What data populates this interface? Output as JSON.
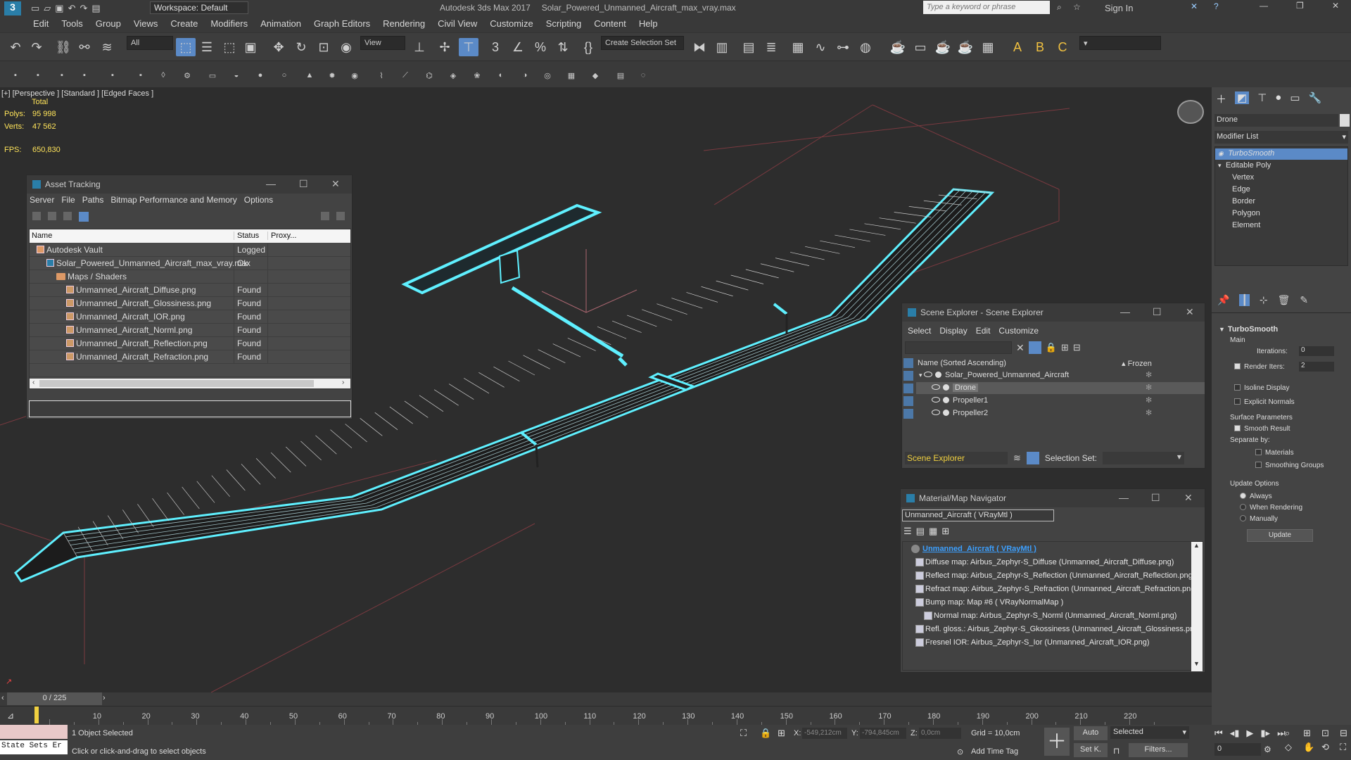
{
  "title": {
    "workspace": "Workspace: Default",
    "app": "Autodesk 3ds Max 2017",
    "file": "Solar_Powered_Unmanned_Aircraft_max_vray.max",
    "search_placeholder": "Type a keyword or phrase",
    "sign_in": "Sign In"
  },
  "menu": [
    "Edit",
    "Tools",
    "Group",
    "Views",
    "Create",
    "Modifiers",
    "Animation",
    "Graph Editors",
    "Rendering",
    "Civil View",
    "Customize",
    "Scripting",
    "Content",
    "Help"
  ],
  "toolbar": {
    "filter": "All",
    "view": "View",
    "selection_set": "Create Selection Set"
  },
  "viewport": {
    "label": "[+] [Perspective ] [Standard ] [Edged Faces ]",
    "total": "Total",
    "polys_label": "Polys:",
    "polys": "95 998",
    "verts_label": "Verts:",
    "verts": "47 562",
    "fps_label": "FPS:",
    "fps": "650,830",
    "wire_color": "#5ff0ff"
  },
  "asset_tracking": {
    "title": "Asset Tracking",
    "menu": [
      "Server",
      "File",
      "Paths",
      "Bitmap Performance and Memory",
      "Options"
    ],
    "columns": [
      "Name",
      "Status",
      "Proxy..."
    ],
    "rows": [
      {
        "name": "Autodesk Vault",
        "status": "Logged ...",
        "indent": 0,
        "icon": "vault-icon"
      },
      {
        "name": "Solar_Powered_Unmanned_Aircraft_max_vray.max",
        "status": "Ok",
        "indent": 1,
        "icon": "max-file-icon"
      },
      {
        "name": "Maps / Shaders",
        "status": "",
        "indent": 2,
        "icon": "folder-icon"
      },
      {
        "name": "Unmanned_Aircraft_Diffuse.png",
        "status": "Found",
        "indent": 3,
        "icon": "image-icon"
      },
      {
        "name": "Unmanned_Aircraft_Glossiness.png",
        "status": "Found",
        "indent": 3,
        "icon": "image-icon"
      },
      {
        "name": "Unmanned_Aircraft_IOR.png",
        "status": "Found",
        "indent": 3,
        "icon": "image-icon"
      },
      {
        "name": "Unmanned_Aircraft_Norml.png",
        "status": "Found",
        "indent": 3,
        "icon": "image-icon"
      },
      {
        "name": "Unmanned_Aircraft_Reflection.png",
        "status": "Found",
        "indent": 3,
        "icon": "image-icon"
      },
      {
        "name": "Unmanned_Aircraft_Refraction.png",
        "status": "Found",
        "indent": 3,
        "icon": "image-icon"
      }
    ]
  },
  "scene_explorer": {
    "title": "Scene Explorer - Scene Explorer",
    "menu": [
      "Select",
      "Display",
      "Edit",
      "Customize"
    ],
    "col_name": "Name (Sorted Ascending)",
    "col_frozen": "▴ Frozen",
    "items": [
      {
        "name": "Solar_Powered_Unmanned_Aircraft",
        "level": 0,
        "selected": false
      },
      {
        "name": "Drone",
        "level": 1,
        "selected": true
      },
      {
        "name": "Propeller1",
        "level": 1,
        "selected": false
      },
      {
        "name": "Propeller2",
        "level": 1,
        "selected": false
      }
    ],
    "footer_label": "Scene Explorer",
    "selection_set": "Selection Set:"
  },
  "material_navigator": {
    "title": "Material/Map Navigator",
    "current": "Unmanned_Aircraft  ( VRayMtl )",
    "items": [
      {
        "text": "Unmanned_Aircraft  ( VRayMtl )",
        "level": 0,
        "selected": true
      },
      {
        "text": "Diffuse map: Airbus_Zephyr-S_Diffuse (Unmanned_Aircraft_Diffuse.png)",
        "level": 1,
        "selected": false
      },
      {
        "text": "Reflect map: Airbus_Zephyr-S_Reflection (Unmanned_Aircraft_Reflection.png)",
        "level": 1,
        "selected": false
      },
      {
        "text": "Refract map: Airbus_Zephyr-S_Refraction (Unmanned_Aircraft_Refraction.png)",
        "level": 1,
        "selected": false
      },
      {
        "text": "Bump map: Map #6  ( VRayNormalMap )",
        "level": 1,
        "selected": false
      },
      {
        "text": "Normal map: Airbus_Zephyr-S_Norml (Unmanned_Aircraft_Norml.png)",
        "level": 2,
        "selected": false
      },
      {
        "text": "Refl. gloss.: Airbus_Zephyr-S_Gkossiness (Unmanned_Aircraft_Glossiness.png)",
        "level": 1,
        "selected": false
      },
      {
        "text": "Fresnel IOR: Airbus_Zephyr-S_Ior (Unmanned_Aircraft_IOR.png)",
        "level": 1,
        "selected": false
      }
    ]
  },
  "command_panel": {
    "object_name": "Drone",
    "modifier_list": "Modifier List",
    "stack": [
      {
        "name": "TurboSmooth",
        "level": 0,
        "selected": true
      },
      {
        "name": "Editable Poly",
        "level": 0,
        "selected": false
      },
      {
        "name": "Vertex",
        "level": 1,
        "selected": false
      },
      {
        "name": "Edge",
        "level": 1,
        "selected": false
      },
      {
        "name": "Border",
        "level": 1,
        "selected": false
      },
      {
        "name": "Polygon",
        "level": 1,
        "selected": false
      },
      {
        "name": "Element",
        "level": 1,
        "selected": false
      }
    ],
    "rollout_title": "TurboSmooth",
    "main": "Main",
    "iterations_label": "Iterations:",
    "iterations": "0",
    "render_iters_label": "Render Iters:",
    "render_iters": "2",
    "isoline": "Isoline Display",
    "explicit_normals": "Explicit Normals",
    "surface_params": "Surface Parameters",
    "smooth_result": "Smooth Result",
    "separate_by": "Separate by:",
    "materials": "Materials",
    "smoothing_groups": "Smoothing Groups",
    "update_options": "Update Options",
    "always": "Always",
    "when_rendering": "When Rendering",
    "manually": "Manually",
    "update": "Update"
  },
  "timeline": {
    "frame": "0 / 225",
    "ticks": [
      "10",
      "20",
      "30",
      "40",
      "50",
      "60",
      "70",
      "80",
      "90",
      "100",
      "110",
      "120",
      "130",
      "140",
      "150",
      "160",
      "170",
      "180",
      "190",
      "200",
      "210",
      "220"
    ]
  },
  "status": {
    "script_label": "State Sets Er",
    "selected": "1 Object Selected",
    "hint": "Click or click-and-drag to select objects",
    "x_label": "X:",
    "x": "-549,212cm",
    "y_label": "Y:",
    "y": "-794,845cm",
    "z_label": "Z:",
    "z": "0,0cm",
    "grid": "Grid = 10,0cm",
    "add_time_tag": "Add Time Tag",
    "auto": "Auto",
    "set_k": "Set K.",
    "selected_dd": "Selected",
    "filters": "Filters...",
    "frame_field": "0"
  }
}
